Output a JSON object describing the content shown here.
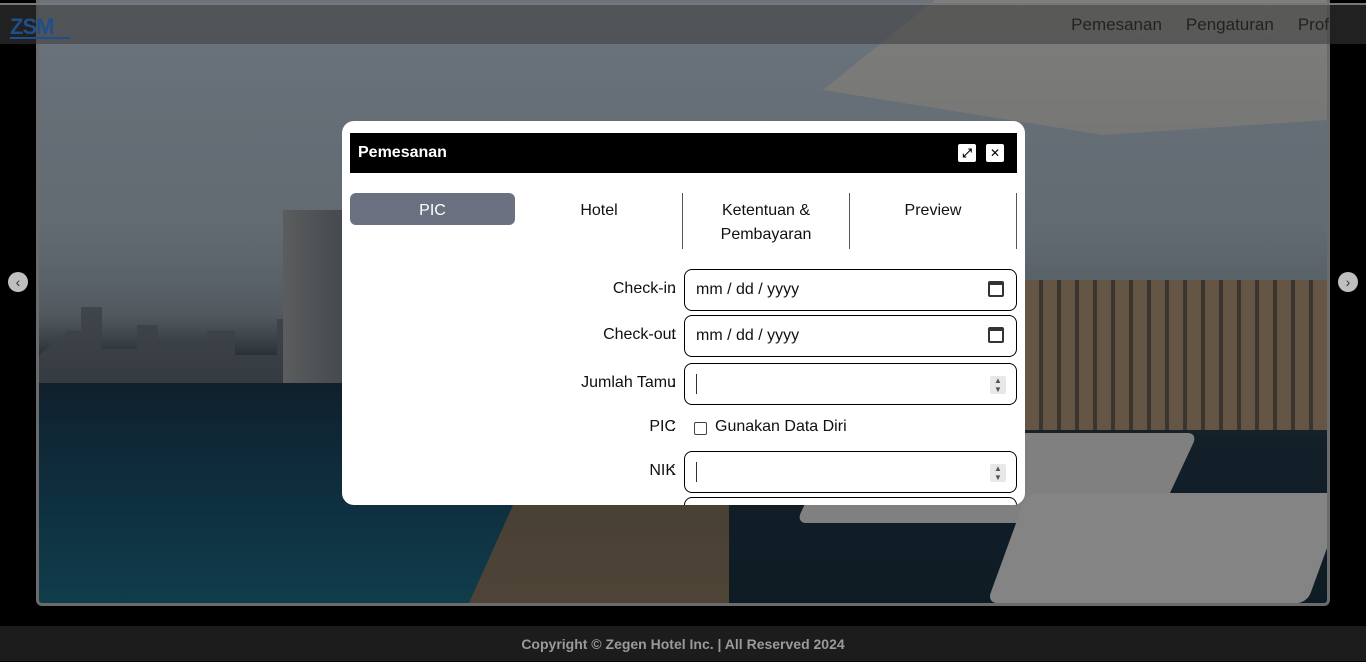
{
  "nav": {
    "logo_icon": "zsm-logo",
    "links": [
      "Pemesanan",
      "Pengaturan",
      "Profile"
    ]
  },
  "carousel": {
    "prev_icon": "chevron-left-icon",
    "next_icon": "chevron-right-icon"
  },
  "modal": {
    "title": "Pemesanan",
    "expand_icon": "expand-icon",
    "close_icon": "close-icon",
    "tabs": [
      {
        "label": "PIC",
        "active": true
      },
      {
        "label": "Hotel",
        "active": false
      },
      {
        "label": "Ketentuan & Pembayaran",
        "active": false
      },
      {
        "label": "Preview",
        "active": false
      }
    ],
    "form": {
      "checkin": {
        "label": "Check-in",
        "placeholder": "mm / dd / yyyy"
      },
      "checkout": {
        "label": "Check-out",
        "placeholder": "mm / dd / yyyy"
      },
      "guests": {
        "label": "Jumlah Tamu",
        "value": ""
      },
      "pic": {
        "label": "PIC",
        "checkbox_label": "Gunakan Data Diri",
        "checked": false
      },
      "nik": {
        "label": "NIK",
        "value": ""
      }
    }
  },
  "footer": {
    "text": "Copyright © Zegen Hotel Inc. | All Reserved 2024"
  },
  "colors": {
    "active_tab": "#6b7180",
    "header": "#000000",
    "footer_bg": "#1c1c1c"
  }
}
